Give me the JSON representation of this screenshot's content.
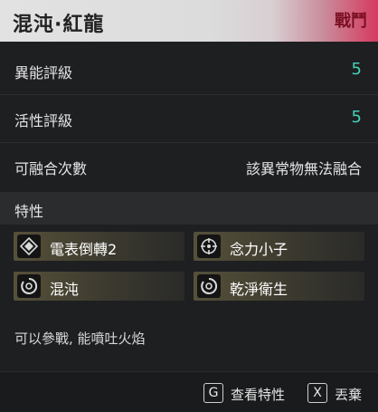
{
  "header": {
    "title": "混沌·紅龍",
    "tag": "戰鬥"
  },
  "stats": [
    {
      "label": "異能評級",
      "value": "5"
    },
    {
      "label": "活性評級",
      "value": "5"
    },
    {
      "label": "可融合次數",
      "value": "該異常物無法融合"
    }
  ],
  "traits": {
    "title": "特性",
    "items": [
      {
        "name": "電表倒轉2",
        "icon": "diamond-icon"
      },
      {
        "name": "念力小子",
        "icon": "crosshair-icon"
      },
      {
        "name": "混沌",
        "icon": "swirl-icon"
      },
      {
        "name": "乾淨衛生",
        "icon": "swirl-icon"
      }
    ]
  },
  "description": "可以參戰, 能噴吐火焰",
  "footer": {
    "view_key": "G",
    "view_label": "查看特性",
    "drop_key": "X",
    "drop_label": "丟棄"
  },
  "colors": {
    "accent": "#45d2b6",
    "header_tag": "#7a0f22",
    "header_pink": "#d6395f"
  }
}
